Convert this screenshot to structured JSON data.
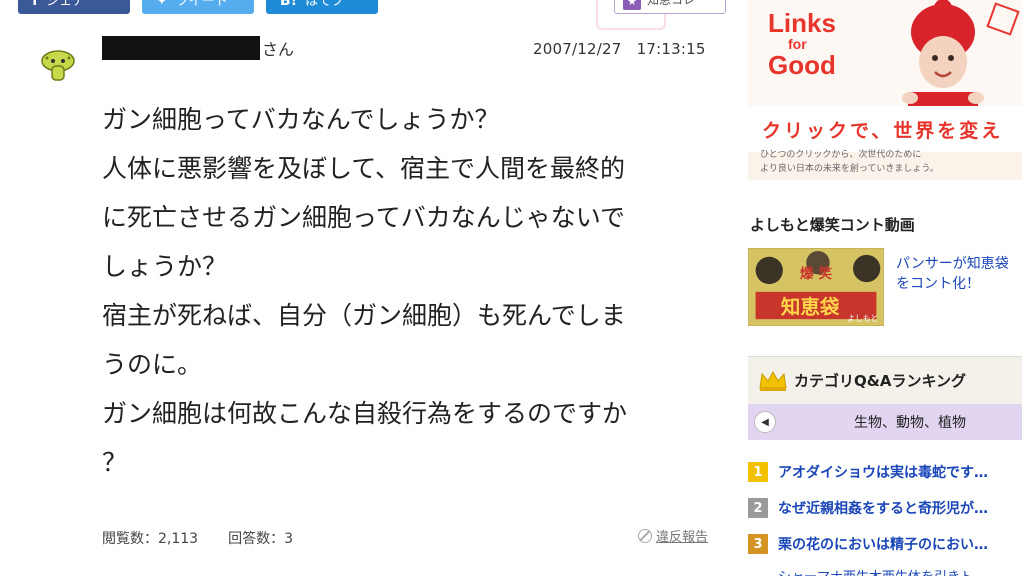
{
  "share": {
    "facebook_label": "シェア",
    "twitter_label": "ツイート",
    "hatena_label": "はてブ",
    "chie_label": "知恵コレ"
  },
  "question": {
    "user_suffix": "さん",
    "timestamp": "2007/12/27　17:13:15",
    "lines": [
      "ガン細胞ってバカなんでしょうか？",
      "人体に悪影響を及ぼして、宿主で人間を最終的",
      "に死亡させるガン細胞ってバカなんじゃないで",
      "しょうか？",
      "宿主が死ねば、自分（ガン細胞）も死んでしま",
      "うのに。",
      "ガン細胞は何故こんな自殺行為をするのですか",
      "？"
    ],
    "views_label": "閲覧数：2,113",
    "answers_label": "回答数：3",
    "report_label": "違反報告"
  },
  "sidebar": {
    "banner": {
      "brand_line1": "Links",
      "brand_line2": "for",
      "brand_line3": "Good",
      "slogan": "クリックで、世界を変え",
      "sub_line1": "ひとつのクリックから、次世代のために",
      "sub_line2": "より良い日本の未来を創っていきましょう。"
    },
    "video_section_title": "よしもと爆笑コント動画",
    "video_thumb_text": "爆笑 知恵袋",
    "video_thumb_small": "よしもと",
    "video_link_line1": "パンサーが知恵袋",
    "video_link_line2": "をコント化！",
    "ranking_title": "カテゴリQ&Aランキング",
    "ranking_tab": "生物、動物、植物",
    "ranking_items": [
      {
        "rank": "1",
        "text": "アオダイショウは実は毒蛇です…"
      },
      {
        "rank": "2",
        "text": "なぜ近親相姦をすると奇形児が…"
      },
      {
        "rank": "3",
        "text": "栗の花のにおいは精子のにおい…"
      }
    ],
    "ranking_partial": "シャーマナ西生木西生体を引きト"
  },
  "colors": {
    "facebook": "#3b5998",
    "twitter": "#55acee",
    "hatena": "#1f8ad6",
    "link_blue": "#1a46b8",
    "banner_red": "#e8352c",
    "rank_tab_purple": "#e2d5f2"
  }
}
